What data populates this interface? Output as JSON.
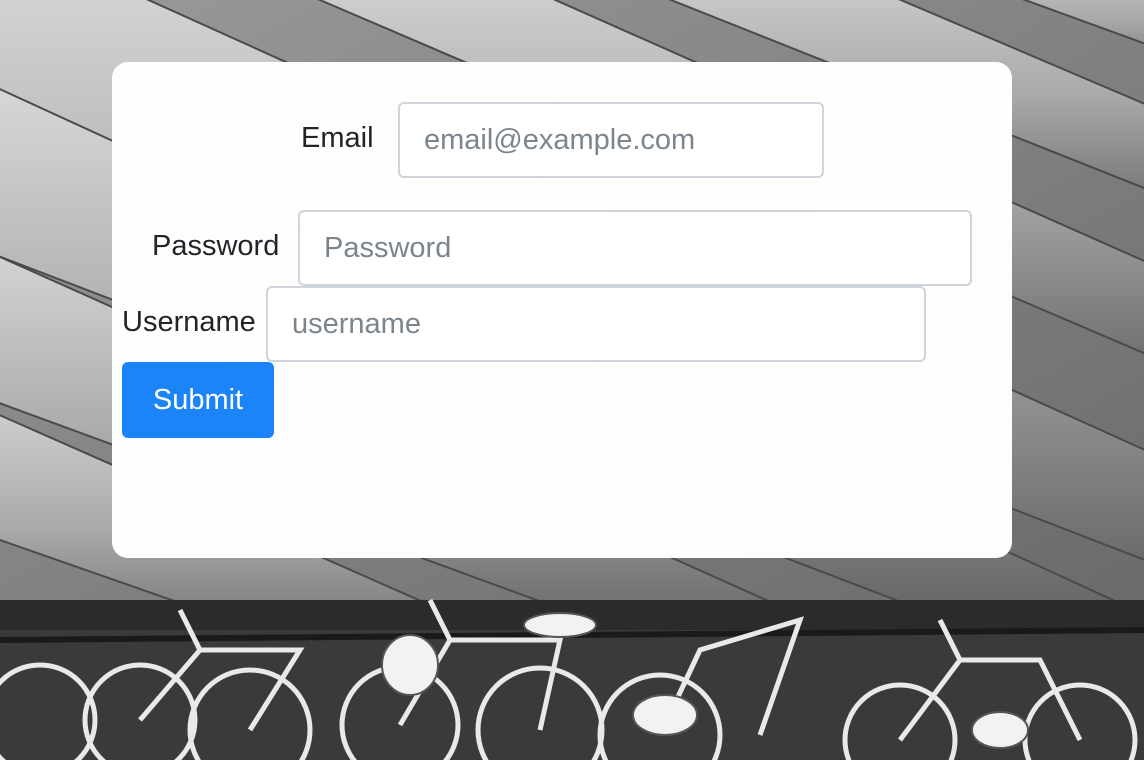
{
  "form": {
    "email": {
      "label": "Email",
      "placeholder": "email@example.com",
      "value": ""
    },
    "password": {
      "label": "Password",
      "placeholder": "Password",
      "value": ""
    },
    "username": {
      "label": "Username",
      "placeholder": "username",
      "value": ""
    },
    "submit_label": "Submit"
  },
  "colors": {
    "primary": "#1a84f8",
    "card_background": "#ffffff",
    "input_border": "#ced4da",
    "placeholder": "#7c858d",
    "text": "#212529"
  }
}
